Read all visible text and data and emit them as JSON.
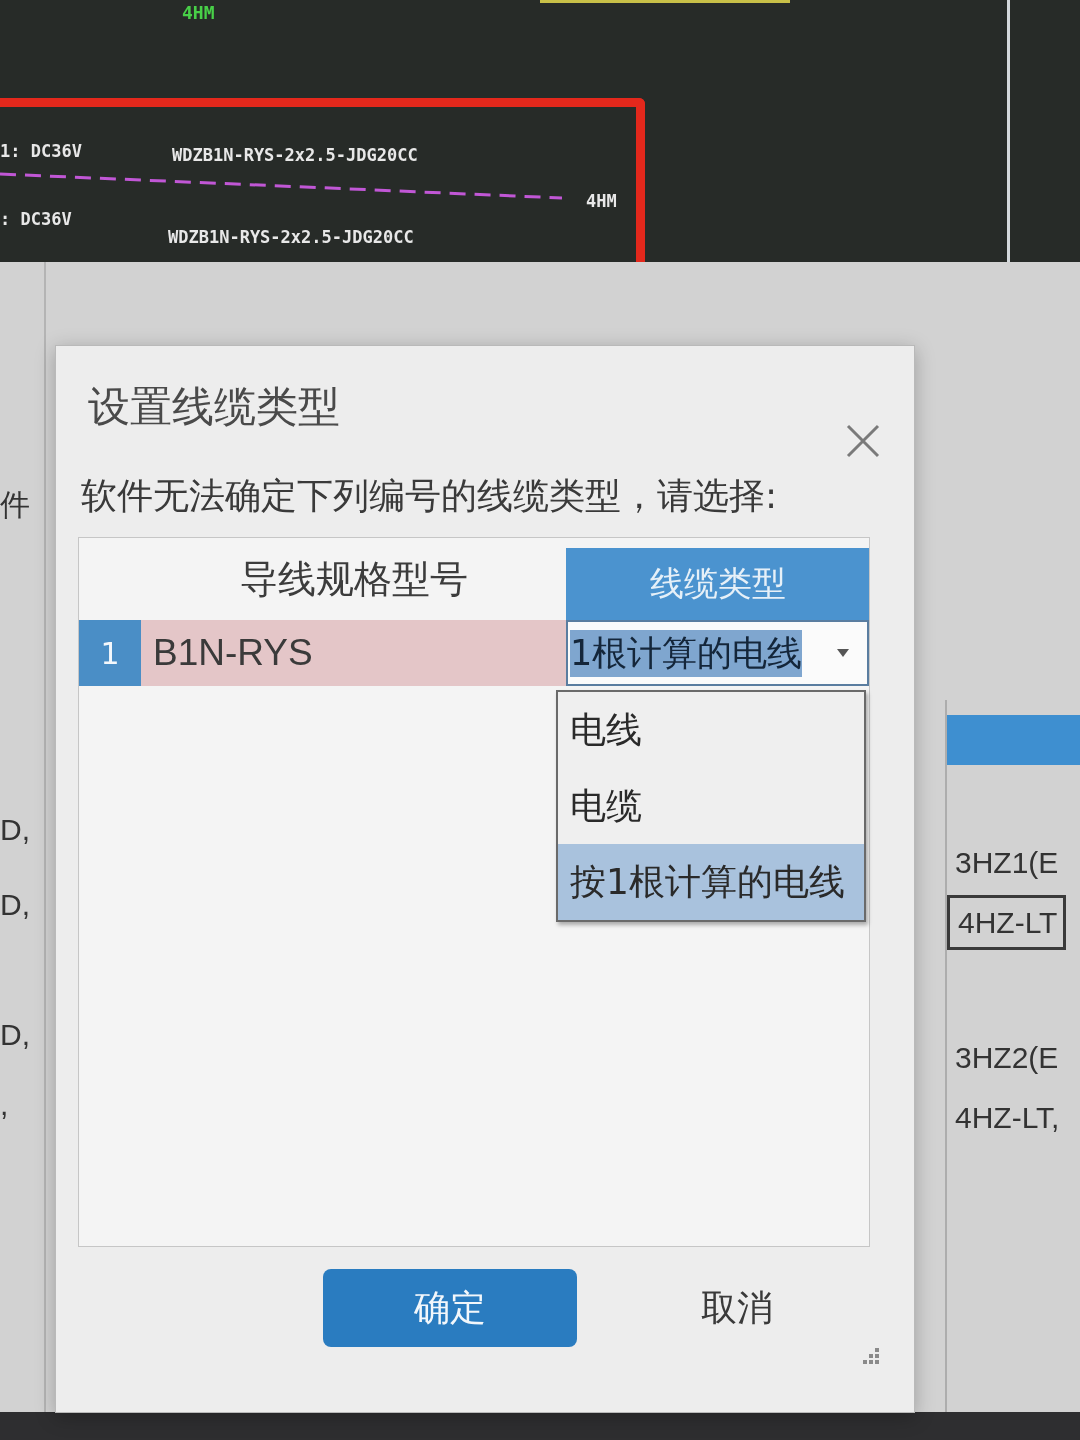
{
  "cad_view": {
    "top_label": "4HM",
    "rows": [
      {
        "circuit": "1: DC36V",
        "cable": "WDZB1N-RYS-2x2.5-JDG20CC",
        "length": "4HM"
      },
      {
        "circuit": ": DC36V",
        "cable": "WDZB1N-RYS-2x2.5-JDG20CC"
      }
    ]
  },
  "background": {
    "left_fragments": [
      "件",
      "D,",
      "D,",
      "D,",
      ","
    ],
    "right_cells": [
      {
        "text": "3HZ1(E",
        "selected": false
      },
      {
        "text": "4HZ-LT",
        "selected": true
      },
      {
        "text": "3HZ2(E",
        "selected": false
      },
      {
        "text": "4HZ-LT,",
        "selected": false
      }
    ]
  },
  "dialog": {
    "title": "设置线缆类型",
    "message": "软件无法确定下列编号的线缆类型，请选择:",
    "table": {
      "columns": [
        "导线规格型号",
        "线缆类型"
      ],
      "rows": [
        {
          "number": "1",
          "spec": "B1N-RYS",
          "selected": true,
          "type": {
            "value": "1根计算的电线",
            "expanded": true,
            "options": [
              {
                "label": "电线",
                "selected": false
              },
              {
                "label": "电缆",
                "selected": false
              },
              {
                "label": "按1根计算的电线",
                "selected": true
              }
            ]
          }
        }
      ]
    },
    "buttons": [
      {
        "label": "确定",
        "kind": "primary"
      },
      {
        "label": "取消",
        "kind": "secondary"
      }
    ]
  }
}
